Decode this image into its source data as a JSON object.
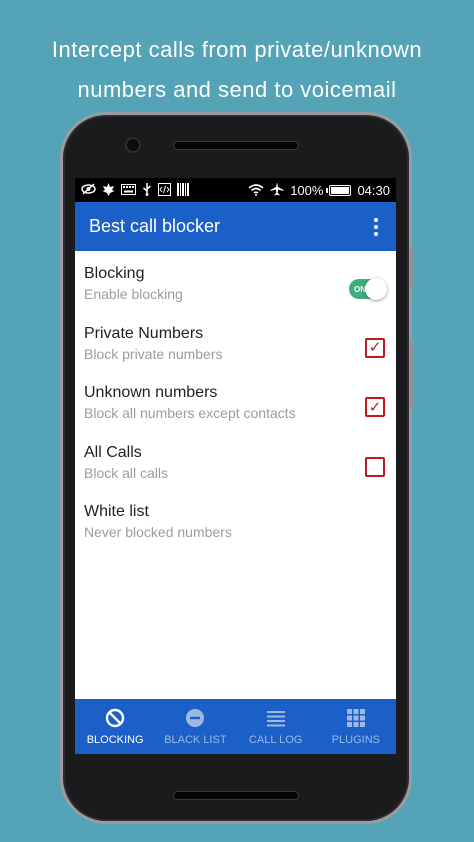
{
  "promo": {
    "line1": "Intercept calls from private/unknown",
    "line2": "numbers and send to voicemail"
  },
  "statusbar": {
    "battery_percent": "100%",
    "time": "04:30",
    "icons": [
      "eye-crossed-icon",
      "leaf-icon",
      "keyboard-icon",
      "usb-icon",
      "code-icon",
      "barcode-icon",
      "wifi-icon",
      "airplane-icon",
      "battery-icon"
    ]
  },
  "appbar": {
    "title": "Best call blocker",
    "menu_icon": "overflow-menu-icon"
  },
  "settings": [
    {
      "title": "Blocking",
      "subtitle": "Enable blocking",
      "control": "toggle",
      "toggle_label": "ON",
      "checked": true
    },
    {
      "title": "Private Numbers",
      "subtitle": "Block private numbers",
      "control": "checkbox",
      "checked": true
    },
    {
      "title": "Unknown numbers",
      "subtitle": "Block all numbers except contacts",
      "control": "checkbox",
      "checked": true
    },
    {
      "title": "All Calls",
      "subtitle": "Block all calls",
      "control": "checkbox",
      "checked": false
    },
    {
      "title": "White list",
      "subtitle": "Never blocked numbers",
      "control": "none"
    }
  ],
  "bottom_nav": {
    "tabs": [
      {
        "label": "BLOCKING",
        "icon": "block-icon",
        "active": true
      },
      {
        "label": "BLACK LIST",
        "icon": "minus-circle-icon",
        "active": false
      },
      {
        "label": "CALL LOG",
        "icon": "list-icon",
        "active": false
      },
      {
        "label": "PLUGINS",
        "icon": "grid-icon",
        "active": false
      }
    ]
  },
  "colors": {
    "background": "#55a3b6",
    "primary": "#1b5fc9",
    "toggle_on": "#3dae7d",
    "checkbox": "#b81c1c"
  }
}
